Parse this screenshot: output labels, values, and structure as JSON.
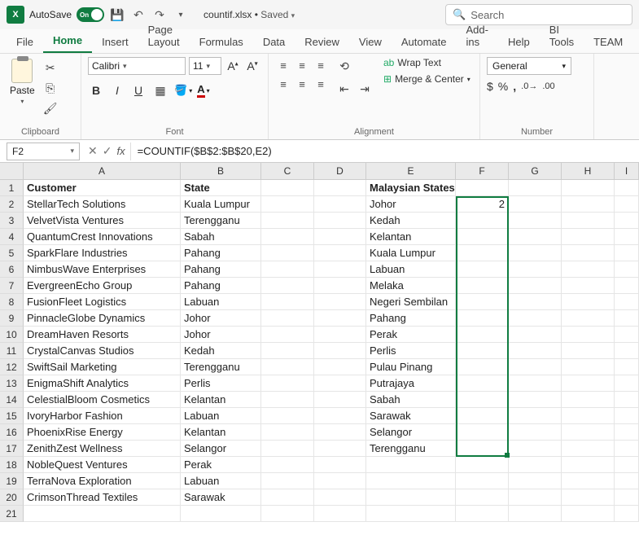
{
  "titlebar": {
    "autosave_label": "AutoSave",
    "autosave_on": "On",
    "filename": "countif.xlsx",
    "saved_status": "Saved",
    "search_placeholder": "Search"
  },
  "tabs": [
    "File",
    "Home",
    "Insert",
    "Page Layout",
    "Formulas",
    "Data",
    "Review",
    "View",
    "Automate",
    "Add-ins",
    "Help",
    "BI Tools",
    "TEAM"
  ],
  "active_tab": "Home",
  "ribbon": {
    "clipboard": {
      "paste": "Paste",
      "group_label": "Clipboard"
    },
    "font": {
      "name": "Calibri",
      "size": "11",
      "bold": "B",
      "italic": "I",
      "underline": "U",
      "group_label": "Font"
    },
    "alignment": {
      "wrap": "Wrap Text",
      "merge": "Merge & Center",
      "group_label": "Alignment"
    },
    "number": {
      "format": "General",
      "group_label": "Number"
    }
  },
  "namebox": "F2",
  "formula": "=COUNTIF($B$2:$B$20,E2)",
  "columns": [
    "A",
    "B",
    "C",
    "D",
    "E",
    "F",
    "G",
    "H",
    "I"
  ],
  "headers": {
    "A": "Customer",
    "B": "State",
    "E": "Malaysian States"
  },
  "rows": [
    {
      "A": "StellarTech Solutions",
      "B": "Kuala Lumpur",
      "E": "Johor",
      "F": "2"
    },
    {
      "A": "VelvetVista Ventures",
      "B": "Terengganu",
      "E": "Kedah"
    },
    {
      "A": "QuantumCrest Innovations",
      "B": "Sabah",
      "E": "Kelantan"
    },
    {
      "A": "SparkFlare Industries",
      "B": "Pahang",
      "E": "Kuala Lumpur"
    },
    {
      "A": "NimbusWave Enterprises",
      "B": "Pahang",
      "E": "Labuan"
    },
    {
      "A": "EvergreenEcho Group",
      "B": "Pahang",
      "E": "Melaka"
    },
    {
      "A": "FusionFleet Logistics",
      "B": "Labuan",
      "E": "Negeri Sembilan"
    },
    {
      "A": "PinnacleGlobe Dynamics",
      "B": "Johor",
      "E": "Pahang"
    },
    {
      "A": "DreamHaven Resorts",
      "B": "Johor",
      "E": "Perak"
    },
    {
      "A": "CrystalCanvas Studios",
      "B": "Kedah",
      "E": "Perlis"
    },
    {
      "A": "SwiftSail Marketing",
      "B": "Terengganu",
      "E": "Pulau Pinang"
    },
    {
      "A": "EnigmaShift Analytics",
      "B": "Perlis",
      "E": "Putrajaya"
    },
    {
      "A": "CelestialBloom Cosmetics",
      "B": "Kelantan",
      "E": "Sabah"
    },
    {
      "A": "IvoryHarbor Fashion",
      "B": "Labuan",
      "E": "Sarawak"
    },
    {
      "A": "PhoenixRise Energy",
      "B": "Kelantan",
      "E": "Selangor"
    },
    {
      "A": "ZenithZest Wellness",
      "B": "Selangor",
      "E": "Terengganu"
    },
    {
      "A": "NobleQuest Ventures",
      "B": "Perak"
    },
    {
      "A": "TerraNova Exploration",
      "B": "Labuan"
    },
    {
      "A": "CrimsonThread Textiles",
      "B": "Sarawak"
    },
    {
      "A": "",
      "B": ""
    }
  ]
}
